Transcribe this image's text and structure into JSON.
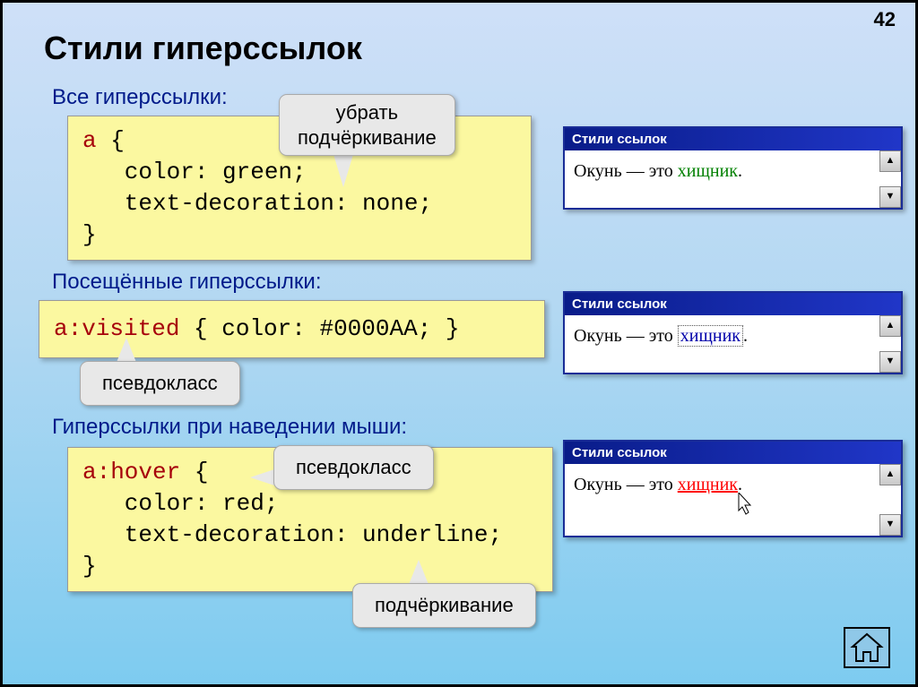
{
  "page_number": "42",
  "title": "Стили гиперссылок",
  "sections": {
    "all": "Все гиперссылки:",
    "visited": "Посещённые гиперссылки:",
    "hover": "Гиперссылки при наведении мыши:"
  },
  "code": {
    "c1_l1_sel": "a",
    "c1_l1_brace": " {",
    "c1_l2": "   color: green;",
    "c1_l3": "   text-decoration: none;",
    "c1_l4": "}",
    "c2_sel": "a:visited",
    "c2_rest": " { color: #0000AA; }",
    "c3_l1_sel": "a:hover",
    "c3_l1_brace": " {",
    "c3_l2": "   color: red;",
    "c3_l3": "   text-decoration: underline;",
    "c3_l4": "}"
  },
  "callouts": {
    "no_underline_l1": "убрать",
    "no_underline_l2": "подчёркивание",
    "pseudo1": "псевдокласс",
    "pseudo2": "псевдокласс",
    "underline": "подчёркивание"
  },
  "browser": {
    "title": "Стили ссылок",
    "text_prefix": "Окунь — это ",
    "link_word": "хищник",
    "dot": "."
  },
  "scroll_up": "▲",
  "scroll_down": "▼"
}
